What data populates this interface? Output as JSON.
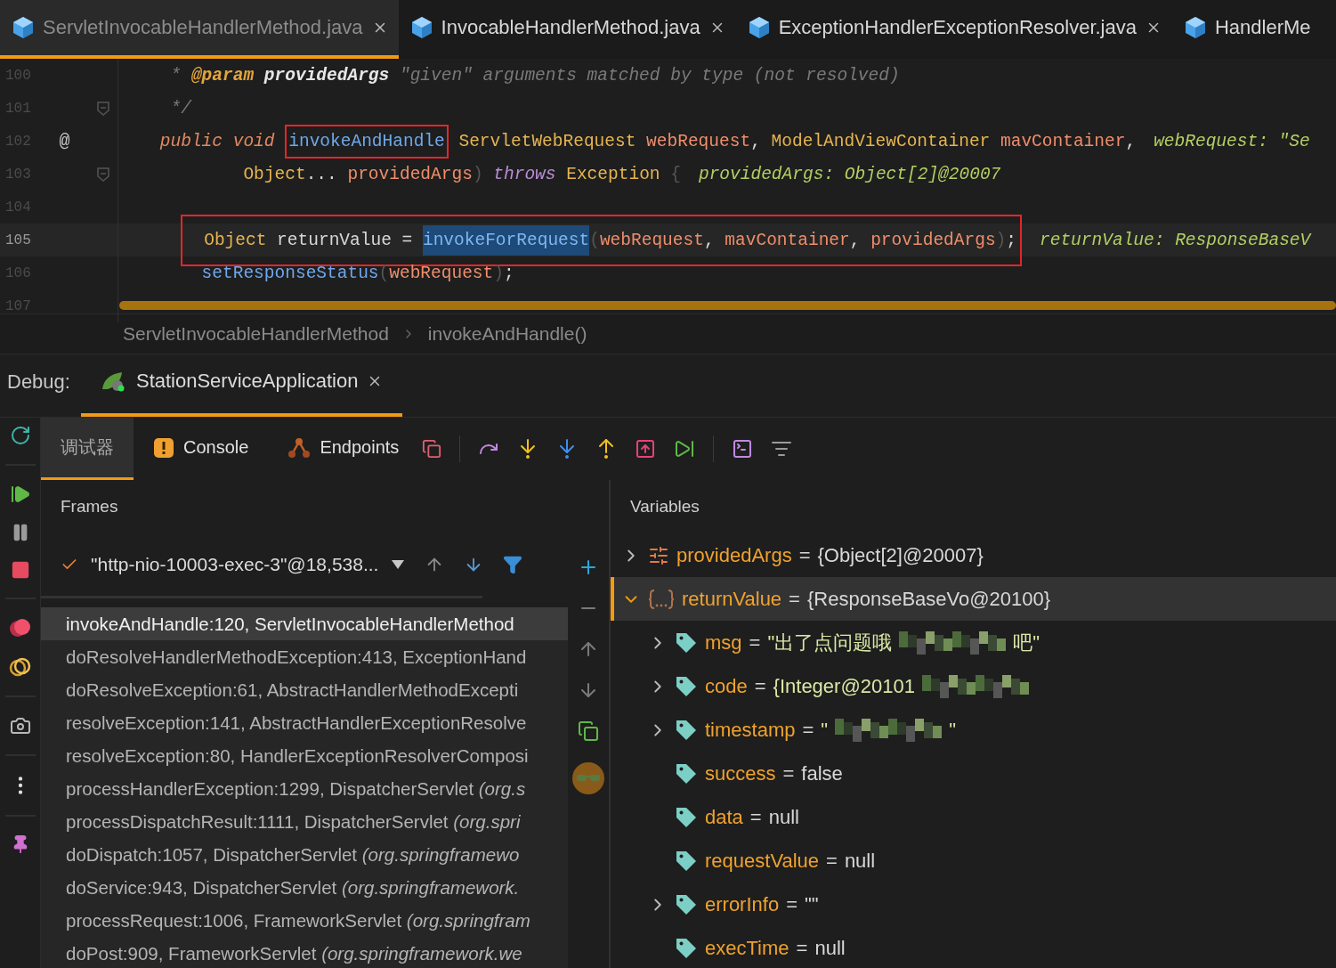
{
  "editor_tabs": [
    {
      "label": "ServletInvocableHandlerMethod.java",
      "selected": true,
      "closable": true
    },
    {
      "label": "InvocableHandlerMethod.java",
      "selected": false,
      "closable": true
    },
    {
      "label": "ExceptionHandlerExceptionResolver.java",
      "selected": false,
      "closable": true
    },
    {
      "label": "HandlerMe",
      "selected": false,
      "closable": false
    }
  ],
  "code_lines": [
    {
      "number": "100",
      "current": false,
      "tokens": [
        {
          "kind": "comment",
          "text": "* "
        },
        {
          "kind": "annotation",
          "text": "@param "
        },
        {
          "kind": "docparam",
          "text": "providedArgs"
        },
        {
          "kind": "comment",
          "text": " \"given\" arguments matched by type (not resolved)"
        }
      ]
    },
    {
      "number": "101",
      "current": false,
      "foldable": true,
      "tokens": [
        {
          "kind": "comment",
          "text": "*/"
        }
      ]
    },
    {
      "number": "102",
      "current": false,
      "gutter_text": "@",
      "tokens": [
        {
          "kind": "keyword",
          "text": "public void "
        },
        {
          "kind": "framed",
          "text": "invokeAndHandle"
        },
        {
          "kind": "type",
          "text": " ServletWebRequest "
        },
        {
          "kind": "param",
          "text": "webRequest"
        },
        {
          "kind": "punct",
          "text": ", "
        },
        {
          "kind": "type",
          "text": "ModelAndViewContainer "
        },
        {
          "kind": "param",
          "text": "mavContainer"
        },
        {
          "kind": "punct",
          "text": ","
        }
      ],
      "hint": "webRequest: \"Se"
    },
    {
      "number": "103",
      "current": false,
      "foldable": true,
      "tokens": [
        {
          "kind": "type",
          "text": "Object"
        },
        {
          "kind": "punct",
          "text": "... "
        },
        {
          "kind": "param",
          "text": "providedArgs"
        },
        {
          "kind": "dim",
          "text": ") "
        },
        {
          "kind": "keyword2",
          "text": "throws "
        },
        {
          "kind": "type",
          "text": "Exception "
        },
        {
          "kind": "dim",
          "text": "{"
        }
      ],
      "hint": "providedArgs: Object[2]@20007"
    },
    {
      "number": "104",
      "current": false
    },
    {
      "number": "105",
      "current": true,
      "framed": true,
      "tokens": [
        {
          "kind": "type",
          "text": "Object"
        },
        {
          "kind": "plain",
          "text": " returnValue = "
        },
        {
          "kind": "selection",
          "text": "invokeForRequest"
        },
        {
          "kind": "dim",
          "text": "("
        },
        {
          "kind": "param",
          "text": "webRequest"
        },
        {
          "kind": "punct",
          "text": ", "
        },
        {
          "kind": "param",
          "text": "mavContainer"
        },
        {
          "kind": "punct",
          "text": ", "
        },
        {
          "kind": "param",
          "text": "providedArgs"
        },
        {
          "kind": "dim",
          "text": ")"
        },
        {
          "kind": "punct",
          "text": ";"
        }
      ],
      "hint": "returnValue: ResponseBaseV"
    },
    {
      "number": "106",
      "current": false,
      "tokens": [
        {
          "kind": "method",
          "text": "setResponseStatus"
        },
        {
          "kind": "dim",
          "text": "("
        },
        {
          "kind": "param",
          "text": "webRequest"
        },
        {
          "kind": "dim",
          "text": ")"
        },
        {
          "kind": "punct",
          "text": ";"
        }
      ]
    },
    {
      "number": "107",
      "current": false
    }
  ],
  "breadcrumbs": [
    "ServletInvocableHandlerMethod",
    "invokeAndHandle()"
  ],
  "debug": {
    "label": "Debug:",
    "session": {
      "label": "StationServiceApplication",
      "selected": true
    }
  },
  "tool_tabs": [
    {
      "label": "调试器",
      "selected": true,
      "kind": "plain"
    },
    {
      "label": "Console",
      "selected": false,
      "kind": "console"
    },
    {
      "label": "Endpoints",
      "selected": false,
      "kind": "endpoints"
    }
  ],
  "frames": {
    "title": "Frames",
    "thread": "\"http-nio-10003-exec-3\"@18,538...",
    "items": [
      {
        "text": "invokeAndHandle:120, ServletInvocableHandlerMethod",
        "selected": true
      },
      {
        "text": "doResolveHandlerMethodException:413, ExceptionHand",
        "selected": false
      },
      {
        "text": "doResolveException:61, AbstractHandlerMethodExcepti",
        "selected": false
      },
      {
        "text": "resolveException:141, AbstractHandlerExceptionResolve",
        "selected": false
      },
      {
        "text": "resolveException:80, HandlerExceptionResolverComposi",
        "selected": false
      },
      {
        "text": "processHandlerException:1299, DispatcherServlet *(org.s*",
        "selected": false
      },
      {
        "text": "processDispatchResult:1111, DispatcherServlet *(org.spri*",
        "selected": false
      },
      {
        "text": "doDispatch:1057, DispatcherServlet *(org.springframewo*",
        "selected": false
      },
      {
        "text": "doService:943, DispatcherServlet *(org.springframework.*",
        "selected": false
      },
      {
        "text": "processRequest:1006, FrameworkServlet *(org.springfram*",
        "selected": false
      },
      {
        "text": "doPost:909, FrameworkServlet *(org.springframework.we*",
        "selected": false
      }
    ]
  },
  "variables": {
    "title": "Variables",
    "items": [
      {
        "name": "providedArgs",
        "operator": "=",
        "value": "{Object[2]@20007}",
        "kind": "array",
        "expandable": true,
        "expanded": false,
        "selected": false
      },
      {
        "name": "returnValue",
        "operator": "=",
        "value": "{ResponseBaseVo@20100}",
        "kind": "object",
        "expandable": true,
        "expanded": true,
        "selected": true,
        "children": [
          {
            "name": "msg",
            "operator": "=",
            "value": "\"出了点问题哦",
            "redacted": true,
            "value_end": "吧\"",
            "kind": "field",
            "expandable": true,
            "expanded": false,
            "selected": false
          },
          {
            "name": "code",
            "operator": "=",
            "value": "{Integer@20101",
            "redacted": true,
            "kind": "field",
            "expandable": true,
            "expanded": false,
            "selected": false
          },
          {
            "name": "timestamp",
            "operator": "=",
            "value": "\"",
            "redacted": true,
            "value_end": "\"",
            "kind": "field",
            "expandable": true,
            "expanded": false,
            "selected": false
          },
          {
            "name": "success",
            "operator": "=",
            "value": "false",
            "kind": "field",
            "expandable": false,
            "selected": false
          },
          {
            "name": "data",
            "operator": "=",
            "value": "null",
            "kind": "field",
            "expandable": false,
            "selected": false
          },
          {
            "name": "requestValue",
            "operator": "=",
            "value": "null",
            "kind": "field",
            "expandable": false,
            "selected": false
          },
          {
            "name": "errorInfo",
            "operator": "=",
            "value": "\"\"",
            "kind": "field",
            "expandable": true,
            "expanded": false,
            "selected": false
          },
          {
            "name": "execTime",
            "operator": "=",
            "value": "null",
            "kind": "field",
            "expandable": false,
            "selected": false
          }
        ]
      }
    ]
  }
}
